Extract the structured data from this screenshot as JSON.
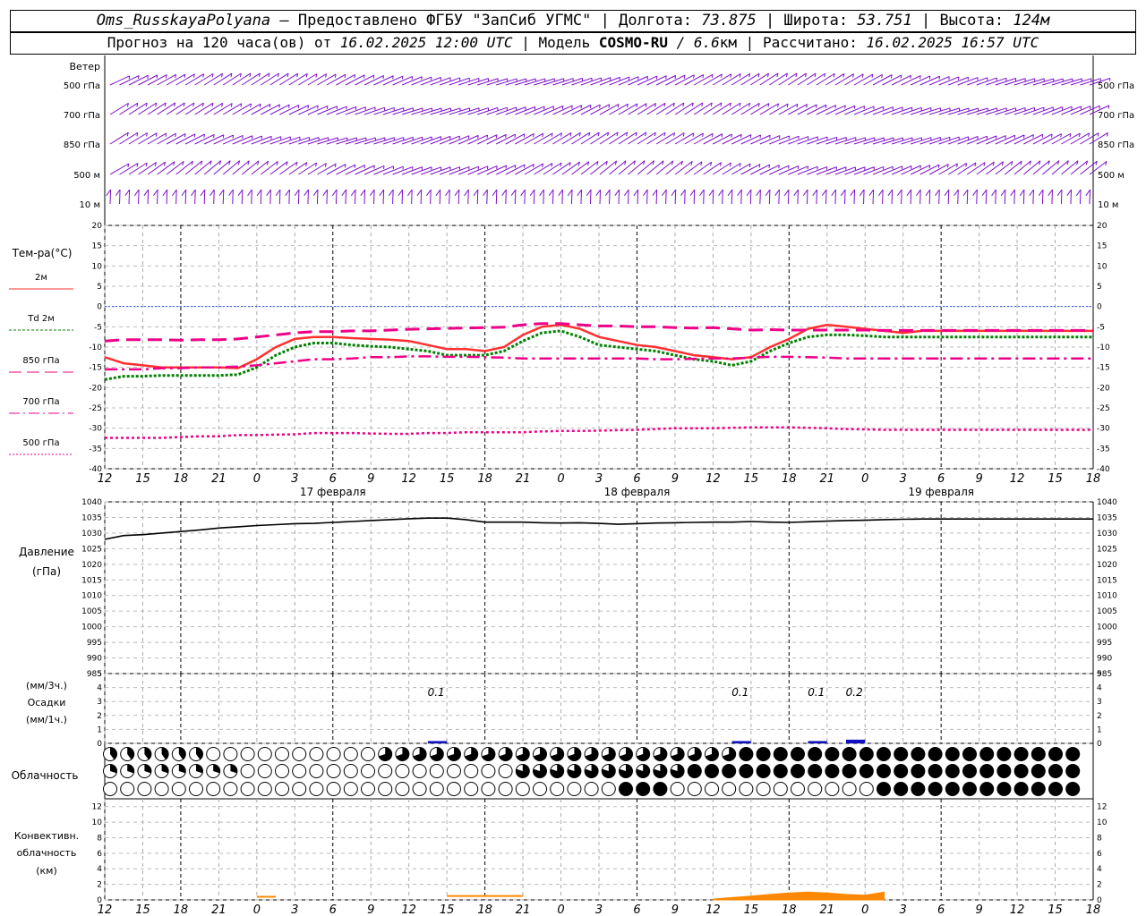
{
  "header": {
    "station": "Oms_RusskayaPolyana",
    "provider": "– Предоставлено ФГБУ \"ЗапСиб УГМС\" |",
    "lon_label": "Долгота:",
    "lon": "73.875",
    "lat_label": "| Широта:",
    "lat": "53.751",
    "alt_label": "| Высота:",
    "alt": "124м",
    "fc_label": "Прогноз на 120 часа(ов) от",
    "fc_time": "16.02.2025 12:00 UTC",
    "model_label": "| Модель",
    "model": "COSMO-RU",
    "res": "/ 6.6",
    "res_unit": "км",
    "calc_label": "| Рассчитано:",
    "calc_time": "16.02.2025 16:57 UTC"
  },
  "panels": {
    "wind": {
      "title": "Ветер",
      "levels": [
        "500 гПа",
        "700 гПа",
        "850 гПа",
        "500 м",
        "10  м"
      ]
    },
    "temp": {
      "title": "Тем-ра(°С)",
      "legend": [
        "2м",
        "Td 2м",
        "850 гПа",
        "700 гПа",
        "500 гПа"
      ],
      "ticks": [
        20,
        15,
        10,
        5,
        0,
        -5,
        -10,
        -15,
        -20,
        -25,
        -30,
        -35,
        -40
      ]
    },
    "pressure": {
      "title_line1": "Давление",
      "title_line2": "(гПа)",
      "ticks": [
        1040,
        1035,
        1030,
        1025,
        1020,
        1015,
        1010,
        1005,
        1000,
        995,
        990,
        985
      ]
    },
    "precip": {
      "title_line1": "(мм/3ч.)",
      "title_line2": "Осадки",
      "title_line3": "(мм/1ч.)",
      "ticks": [
        5,
        4,
        3,
        2,
        1,
        0
      ],
      "labels": [
        {
          "hour": 54,
          "text": "0.1"
        },
        {
          "hour": 102,
          "text": "0.1"
        },
        {
          "hour": 114,
          "text": "0.1"
        },
        {
          "hour": 120,
          "text": "0.2"
        }
      ]
    },
    "cloud": {
      "title": "Облачность"
    },
    "conv": {
      "title_line1": "Конвективн.",
      "title_line2": "облачность",
      "title_line3": "(км)",
      "ticks": [
        12,
        10,
        8,
        6,
        4,
        2,
        0
      ]
    }
  },
  "time_axis": {
    "hour_labels": [
      "12",
      "15",
      "18",
      "21",
      "0",
      "3",
      "6",
      "9",
      "12",
      "15",
      "18",
      "21",
      "0",
      "3",
      "6",
      "9",
      "12",
      "15",
      "18",
      "21",
      "0",
      "3",
      "6",
      "9",
      "12",
      "15",
      "18"
    ],
    "dates": [
      {
        "hour": 36,
        "text": "17 февраля"
      },
      {
        "hour": 84,
        "text": "18 февраля"
      },
      {
        "hour": 132,
        "text": "19 февраля"
      }
    ],
    "midnights": [
      12,
      36,
      60,
      84,
      108,
      132,
      156
    ]
  },
  "colors": {
    "t2m": "#ff3030",
    "td2m": "#008000",
    "t850": "#ee0088",
    "wind": "#7a10c8",
    "pressure": "#000000",
    "precip": "#1010c0",
    "conv": "#ff8800",
    "zero": "#3050ff"
  },
  "chart_data": [
    {
      "type": "line",
      "x": [
        0,
        3,
        6,
        9,
        12,
        15,
        18,
        21,
        24,
        27,
        30,
        33,
        36,
        39,
        42,
        45,
        48,
        51,
        54,
        57,
        60,
        63,
        66,
        69,
        72,
        75,
        78,
        81,
        84,
        87,
        90,
        93,
        96,
        99,
        102,
        105,
        108,
        111,
        114,
        117,
        120,
        123,
        126,
        129,
        132,
        135,
        138,
        141,
        144,
        147,
        150,
        153,
        156
      ],
      "series": [
        {
          "name": "2м",
          "values": [
            -12.5,
            -14,
            -14.5,
            -15,
            -15,
            -15,
            -15,
            -15.2,
            -13,
            -10,
            -8,
            -7.5,
            -7.5,
            -7.8,
            -8,
            -8.2,
            -8.5,
            -9.5,
            -10.5,
            -10.5,
            -11,
            -10,
            -7,
            -5,
            -4.5,
            -5.5,
            -7.5,
            -8.5,
            -9.5,
            -10,
            -11,
            -12,
            -12.5,
            -13,
            -12.5,
            -10,
            -8,
            -5.5,
            -4.5,
            -5,
            -5.5,
            -6,
            -6.5,
            -6,
            -6,
            -6,
            -6,
            -6,
            -6,
            -6,
            -6,
            -6,
            -6
          ]
        },
        {
          "name": "Td 2м",
          "values": [
            -18,
            -17.2,
            -17.2,
            -17,
            -17,
            -17,
            -17,
            -16.8,
            -15,
            -12,
            -10,
            -9,
            -9,
            -9.5,
            -9.8,
            -10,
            -10.5,
            -11,
            -12,
            -12,
            -12,
            -11,
            -8.5,
            -6.5,
            -6,
            -7.5,
            -9.5,
            -10,
            -10.5,
            -11,
            -12,
            -13,
            -13.5,
            -14.5,
            -13.5,
            -11,
            -9,
            -7.5,
            -7,
            -7,
            -7.2,
            -7.5,
            -7.5,
            -7.5,
            -7.5,
            -7.5,
            -7.5,
            -7.5,
            -7.5,
            -7.5,
            -7.5,
            -7.5,
            -7.5
          ]
        },
        {
          "name": "850 гПа",
          "values": [
            -8.5,
            -8.2,
            -8.2,
            -8.2,
            -8.3,
            -8.2,
            -8.2,
            -8,
            -7.5,
            -7,
            -6.5,
            -6.2,
            -6.2,
            -6,
            -6,
            -5.8,
            -5.6,
            -5.5,
            -5.4,
            -5.3,
            -5.2,
            -5.1,
            -4.5,
            -4.2,
            -4.2,
            -4.5,
            -4.8,
            -4.8,
            -5,
            -5,
            -5.2,
            -5.3,
            -5.2,
            -5.5,
            -5.8,
            -5.7,
            -5.8,
            -5.8,
            -5.8,
            -5.8,
            -5.8,
            -5.9,
            -5.9,
            -5.9,
            -5.9,
            -5.9,
            -5.9,
            -5.9,
            -5.9,
            -5.9,
            -5.9,
            -5.9,
            -5.9
          ]
        },
        {
          "name": "700 гПа",
          "values": [
            -15.5,
            -15.5,
            -15.5,
            -15.2,
            -15.2,
            -15,
            -15,
            -14.8,
            -14.5,
            -14,
            -13.5,
            -13,
            -13,
            -12.8,
            -12.5,
            -12.5,
            -12.3,
            -12.3,
            -12.4,
            -12.4,
            -12.5,
            -12.6,
            -12.8,
            -12.8,
            -12.8,
            -12.8,
            -12.8,
            -12.8,
            -12.8,
            -13,
            -13,
            -12.9,
            -12.8,
            -12.8,
            -12.6,
            -12.4,
            -12.4,
            -12.5,
            -12.6,
            -12.8,
            -12.8,
            -12.8,
            -12.8,
            -12.8,
            -12.8,
            -12.8,
            -12.8,
            -12.8,
            -12.8,
            -12.8,
            -12.8,
            -12.8,
            -12.8
          ]
        },
        {
          "name": "500 гПа",
          "values": [
            -32.4,
            -32.4,
            -32.4,
            -32.4,
            -32.2,
            -32,
            -32,
            -31.7,
            -31.7,
            -31.6,
            -31.5,
            -31.2,
            -31.2,
            -31.2,
            -31.3,
            -31.4,
            -31.4,
            -31.2,
            -31.2,
            -31,
            -31,
            -31,
            -31,
            -30.8,
            -30.7,
            -30.7,
            -30.6,
            -30.5,
            -30.4,
            -30.2,
            -30,
            -30,
            -30,
            -29.9,
            -29.8,
            -29.8,
            -29.8,
            -29.9,
            -30,
            -30.2,
            -30.3,
            -30.4,
            -30.4,
            -30.4,
            -30.4,
            -30.4,
            -30.4,
            -30.4,
            -30.4,
            -30.4,
            -30.4,
            -30.4,
            -30.4
          ]
        }
      ],
      "ylabel": "Тем-ра(°С)",
      "ylim": [
        -40,
        20
      ]
    },
    {
      "type": "line",
      "x": [
        0,
        3,
        6,
        9,
        12,
        15,
        18,
        21,
        24,
        27,
        30,
        33,
        36,
        39,
        42,
        45,
        48,
        51,
        54,
        57,
        60,
        63,
        66,
        69,
        72,
        75,
        78,
        81,
        84,
        87,
        90,
        93,
        96,
        99,
        102,
        105,
        108,
        111,
        114,
        117,
        120,
        123,
        126,
        129,
        132,
        135,
        138,
        141,
        144,
        147,
        150,
        153,
        156
      ],
      "series": [
        {
          "name": "Давление",
          "values": [
            1028,
            1029.2,
            1029.5,
            1030,
            1030.5,
            1031,
            1031.6,
            1032,
            1032.4,
            1032.7,
            1033,
            1033.1,
            1033.4,
            1033.7,
            1034,
            1034.3,
            1034.6,
            1034.8,
            1034.8,
            1034.3,
            1033.5,
            1033.5,
            1033.5,
            1033.3,
            1033.2,
            1033.3,
            1033.1,
            1032.8,
            1033,
            1033.2,
            1033.3,
            1033.4,
            1033.5,
            1033.5,
            1033.7,
            1033.5,
            1033.4,
            1033.6,
            1033.8,
            1034,
            1034.1,
            1034.3,
            1034.4,
            1034.5,
            1034.5,
            1034.5,
            1034.5,
            1034.5,
            1034.5,
            1034.5,
            1034.5,
            1034.5,
            1034.5
          ]
        }
      ],
      "ylabel": "Давление (гПа)",
      "ylim": [
        985,
        1040
      ]
    },
    {
      "type": "bar",
      "x_hours": [
        54,
        102,
        114,
        120
      ],
      "values": [
        0.1,
        0.1,
        0.1,
        0.2
      ],
      "ylim": [
        0,
        5
      ]
    },
    {
      "type": "area",
      "x_hours": [
        96,
        99,
        102,
        105,
        108,
        111,
        114,
        117,
        120,
        123
      ],
      "values": [
        0.1,
        0.3,
        0.5,
        0.7,
        0.9,
        1.0,
        0.9,
        0.7,
        0.6,
        1.0
      ],
      "ylim": [
        0,
        13
      ]
    }
  ]
}
